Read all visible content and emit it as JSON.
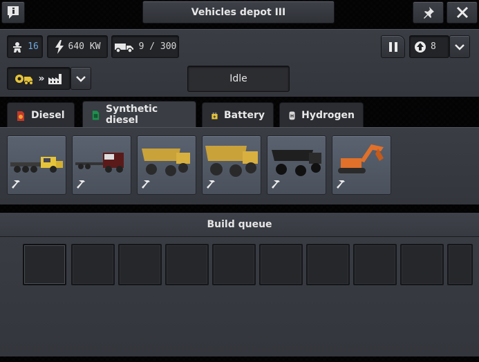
{
  "window": {
    "title": "Vehicles depot III"
  },
  "stats": {
    "workers": "16",
    "power": "640 KW",
    "vehicles": "9 / 300"
  },
  "controls": {
    "status": "Idle",
    "priority": "8"
  },
  "tabs": [
    {
      "label": "Diesel",
      "icon": "diesel-canister-icon",
      "active": false
    },
    {
      "label": "Synthetic diesel",
      "icon": "synthetic-diesel-icon",
      "active": true
    },
    {
      "label": "Battery",
      "icon": "battery-icon",
      "active": false
    },
    {
      "label": "Hydrogen",
      "icon": "hydrogen-icon",
      "active": false
    }
  ],
  "vehicles": [
    {
      "name": "truck-flatbed",
      "icon": "hammer-icon"
    },
    {
      "name": "truck-cab-red",
      "icon": "hammer-icon"
    },
    {
      "name": "dump-truck-small",
      "icon": "hammer-icon"
    },
    {
      "name": "dump-truck-large",
      "icon": "hammer-icon"
    },
    {
      "name": "truck-chassis-black",
      "icon": "hammer-icon"
    },
    {
      "name": "excavator",
      "icon": "hammer-icon"
    }
  ],
  "queue": {
    "title": "Build queue"
  },
  "colors": {
    "accent_blue": "#6fa8dc",
    "yellow": "#e6c43a",
    "orange": "#e0702a"
  }
}
